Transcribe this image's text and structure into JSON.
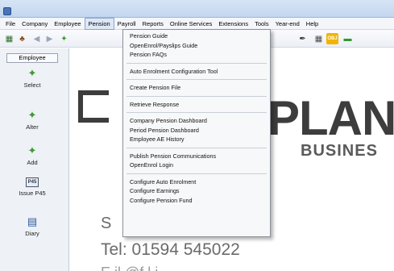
{
  "menubar": {
    "items": [
      "File",
      "Company",
      "Employee",
      "Pension",
      "Payroll",
      "Reports",
      "Online Services",
      "Extensions",
      "Tools",
      "Year-end",
      "Help"
    ],
    "active": "Pension"
  },
  "toolbar": {
    "icons": [
      "employee-icon",
      "company-icon",
      "back-arrow-icon",
      "forward-arrow-icon",
      "select-icon",
      "pen-icon",
      "calculator-icon",
      "obj-icon",
      "green-link-icon"
    ]
  },
  "side": {
    "header": "Employee",
    "items": [
      {
        "label": "Select"
      },
      {
        "label": "Alter"
      },
      {
        "label": "Add"
      },
      {
        "label": "Issue P45",
        "icon_text": "P45"
      },
      {
        "label": "Diary"
      }
    ]
  },
  "main": {
    "logo": "PLAN",
    "logo_sub": "BUSINES",
    "contact_frag": "S",
    "phone": "Tel: 01594 545022",
    "bottom_frag": "E   il                      @f            l        i"
  },
  "dropdown": {
    "groups": [
      [
        "Pension Guide",
        "OpenEnrol/Payslips Guide",
        "Pension FAQs"
      ],
      [
        "Auto Enrolment Configuration Tool"
      ],
      [
        "Create Pension File"
      ],
      [
        "Retrieve Response"
      ],
      [
        "Company Pension Dashboard",
        "Period Pension Dashboard",
        "Employee AE History"
      ],
      [
        "Publish Pension Communications",
        "OpenEnrol Login"
      ],
      [
        "Configure Auto Enrolment",
        "Configure Earnings",
        "Configure Pension Fund"
      ]
    ]
  },
  "colors": {
    "accent": "#8aa6cf",
    "menu_active_bg": "#dde7f5",
    "panel_bg": "#eef1f6"
  }
}
